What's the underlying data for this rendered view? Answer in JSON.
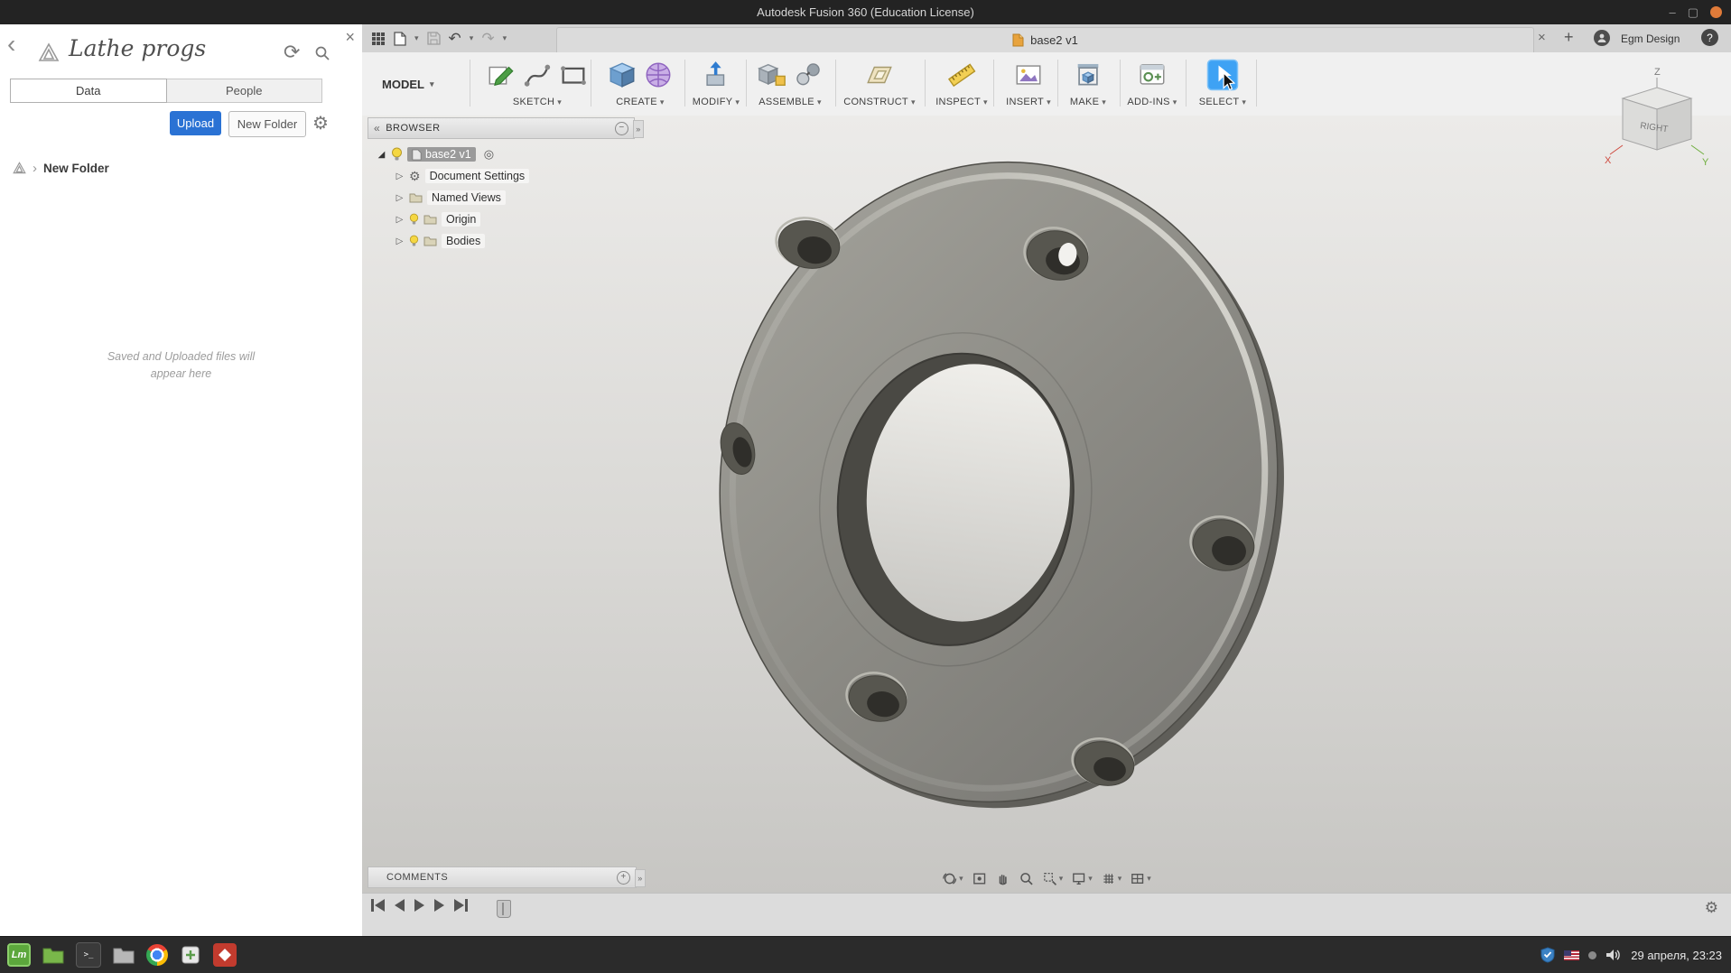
{
  "colors": {
    "accent_blue": "#2a72d4",
    "select_highlight": "#3ea2f4",
    "tab_icon_orange": "#e0912f",
    "mint_green": "#5ca73c",
    "titlebar_bg": "#232323",
    "taskbar_bg": "#2b2b2b"
  },
  "icons": {
    "back": "‹",
    "refresh": "⟳",
    "close": "×",
    "gear": "⚙",
    "chevron": "›",
    "caret": "▾",
    "expander_open": "◢",
    "expander_closed": "▷",
    "radio": "◎",
    "minus": "−",
    "plus": "+",
    "undo": "↶",
    "redo": "↷",
    "help": "?",
    "minimize": "–",
    "maximize": "▢",
    "collapse_left": "«",
    "handle_right": "»",
    "mint": "Lm",
    "terminal": ">_"
  },
  "titlebar": {
    "title": "Autodesk Fusion 360 (Education License)"
  },
  "data_panel": {
    "title": "Lathe progs",
    "tabs": [
      {
        "label": "Data"
      },
      {
        "label": "People"
      }
    ],
    "upload_button": "Upload",
    "new_folder_button": "New Folder",
    "folder_item": "New Folder",
    "empty_message_line1": "Saved and Uploaded files will",
    "empty_message_line2": "appear here"
  },
  "tab_bar": {
    "active_tab": "base2 v1",
    "account_name": "Egm Design"
  },
  "ribbon": {
    "workspace": "MODEL",
    "groups": [
      {
        "label": "SKETCH"
      },
      {
        "label": "CREATE"
      },
      {
        "label": "MODIFY"
      },
      {
        "label": "ASSEMBLE"
      },
      {
        "label": "CONSTRUCT"
      },
      {
        "label": "INSPECT"
      },
      {
        "label": "INSERT"
      },
      {
        "label": "MAKE"
      },
      {
        "label": "ADD-INS"
      },
      {
        "label": "SELECT"
      }
    ]
  },
  "browser": {
    "header": "BROWSER",
    "root_label": "base2 v1",
    "items": [
      {
        "label": "Document Settings"
      },
      {
        "label": "Named Views"
      },
      {
        "label": "Origin"
      },
      {
        "label": "Bodies"
      }
    ]
  },
  "viewcube": {
    "face_label": "RIGHT",
    "axis_x": "X",
    "axis_y": "Y",
    "axis_z": "Z"
  },
  "comments": {
    "header": "COMMENTS"
  },
  "taskbar": {
    "clock": "29 апреля, 23:23"
  }
}
